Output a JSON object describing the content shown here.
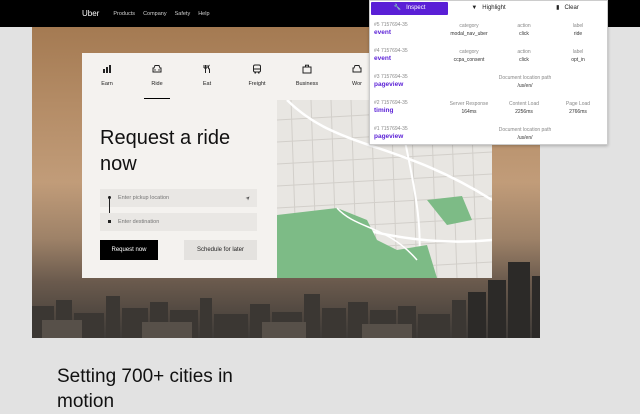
{
  "nav": {
    "logo": "Uber",
    "links": [
      "Products",
      "Company",
      "Safety",
      "Help"
    ]
  },
  "tabs": [
    {
      "label": "Earn",
      "icon": "bar-chart-icon"
    },
    {
      "label": "Ride",
      "icon": "car-icon",
      "active": true
    },
    {
      "label": "Eat",
      "icon": "fork-knife-icon"
    },
    {
      "label": "Freight",
      "icon": "truck-icon"
    },
    {
      "label": "Business",
      "icon": "briefcase-icon"
    },
    {
      "label": "Wor",
      "icon": "car-icon"
    }
  ],
  "hero": {
    "title": "Request a ride now",
    "pickup_placeholder": "Enter pickup location",
    "destination_placeholder": "Enter destination",
    "request_button": "Request now",
    "schedule_button": "Schedule for later"
  },
  "section": {
    "heading": "Setting 700+ cities in motion"
  },
  "debugger": {
    "buttons": {
      "inspect": "Inspect",
      "highlight": "Highlight",
      "clear": "Clear"
    },
    "accent": "#5a1fd6",
    "hits": [
      {
        "id": "#5 7157694-35",
        "type": "event",
        "fields": [
          {
            "key": "category",
            "value": "modal_nav_uber"
          },
          {
            "key": "action",
            "value": "click"
          },
          {
            "key": "label",
            "value": "ride"
          }
        ]
      },
      {
        "id": "#4 7157694-35",
        "type": "event",
        "fields": [
          {
            "key": "category",
            "value": "ccpa_consent"
          },
          {
            "key": "action",
            "value": "click"
          },
          {
            "key": "label",
            "value": "opt_in"
          }
        ]
      },
      {
        "id": "#3 7157694-35",
        "type": "pageview",
        "fields": [
          {
            "key": "Document location path",
            "value": "/us/en/"
          }
        ]
      },
      {
        "id": "#2 7157694-35",
        "type": "timing",
        "fields": [
          {
            "key": "Server Response",
            "value": "164ms"
          },
          {
            "key": "Content Load",
            "value": "2256ms"
          },
          {
            "key": "Page Load",
            "value": "2766ms"
          }
        ]
      },
      {
        "id": "#1 7157694-35",
        "type": "pageview",
        "fields": [
          {
            "key": "Document location path",
            "value": "/us/en/"
          }
        ]
      }
    ]
  }
}
